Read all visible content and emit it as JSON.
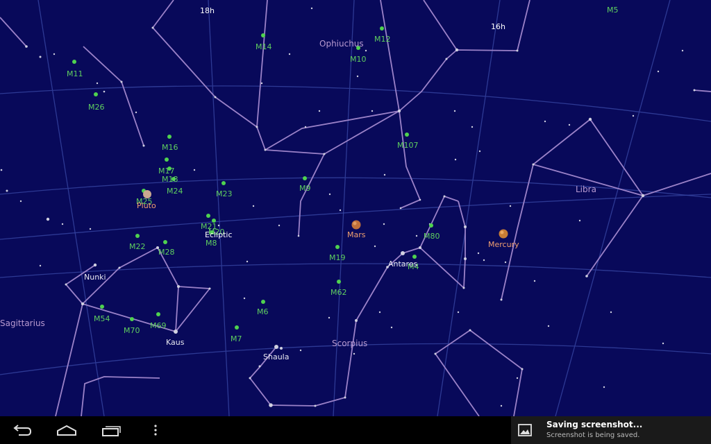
{
  "sky": {
    "ra_labels": {
      "h18": "18h",
      "h16": "16h"
    },
    "constellations": {
      "ophiuchus": "Ophiuchus",
      "libra": "Libra",
      "sagittarius": "Sagittarius",
      "scorpius": "Scorpius"
    },
    "messier": {
      "m5": "M5",
      "m14": "M14",
      "m12": "M12",
      "m10": "M10",
      "m11": "M11",
      "m26": "M26",
      "m107": "M107",
      "m16": "M16",
      "m17": "M17",
      "m18": "M18",
      "m24": "M24",
      "m25": "M25",
      "m9": "M9",
      "m23": "M23",
      "m21": "M21",
      "m20": "M20",
      "m8": "M8",
      "m22": "M22",
      "m28": "M28",
      "m80": "M80",
      "m19": "M19",
      "m4": "M4",
      "m62": "M62",
      "m6": "M6",
      "m54": "M54",
      "m70": "M70",
      "m69": "M69",
      "m7": "M7"
    },
    "stars": {
      "nunki": "Nunki",
      "kaus": "Kaus",
      "shaula": "Shaula",
      "antares": "Antares"
    },
    "planets": {
      "pluto": "Pluto",
      "mars": "Mars",
      "mercury": "Mercury"
    },
    "ecliptic": "Ecliptic",
    "colors": {
      "sky": "#08095a",
      "grid": "#3a4aa8",
      "constellation": "#9b82c8",
      "messier": "#5fcf5f",
      "planet_label": "#f0a070",
      "star_label": "#e8e8f0"
    }
  },
  "navbar": {
    "icons": [
      "back-icon",
      "home-icon",
      "recent-apps-icon",
      "menu-icon"
    ]
  },
  "notification": {
    "title": "Saving screenshot...",
    "text": "Screenshot is being saved.",
    "icon": "image-icon"
  }
}
